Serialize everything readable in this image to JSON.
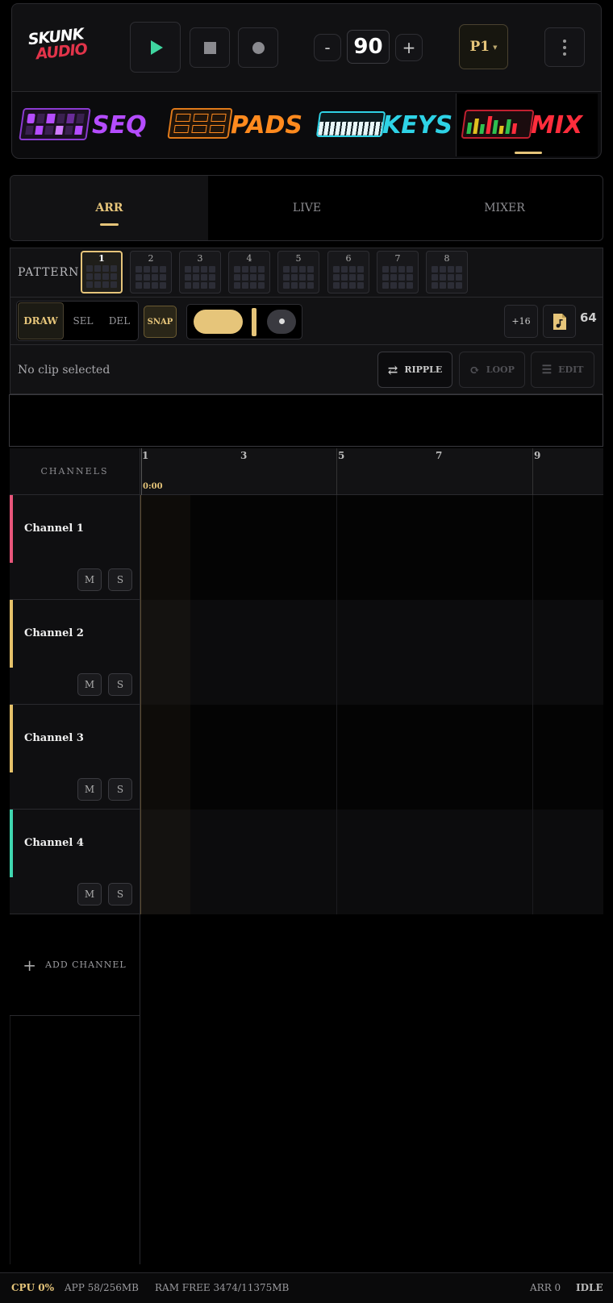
{
  "header": {
    "logo_line1": "SKUNK",
    "logo_line2": "AUDIO",
    "tempo": "90",
    "tempo_minus": "-",
    "tempo_plus": "+",
    "preset": "P1"
  },
  "modules": [
    {
      "label": "SEQ",
      "color": "#b54cff"
    },
    {
      "label": "PADS",
      "color": "#ff8a1e"
    },
    {
      "label": "KEYS",
      "color": "#2ed3e6"
    },
    {
      "label": "MIX",
      "color": "#ff2d3c"
    }
  ],
  "tabs": [
    "ARR",
    "LIVE",
    "MIXER"
  ],
  "active_tab": "ARR",
  "pattern": {
    "label": "PATTERN",
    "slots": [
      "1",
      "2",
      "3",
      "4",
      "5",
      "6",
      "7",
      "8"
    ],
    "active": "1"
  },
  "tools": {
    "draw": "DRAW",
    "sel": "SEL",
    "del": "DEL",
    "snap": "SNAP",
    "plus16": "+16",
    "length": "64"
  },
  "clip": {
    "status": "No clip selected",
    "ripple": "RIPPLE",
    "loop": "LOOP",
    "edit": "EDIT"
  },
  "timeline": {
    "channels_header": "CHANNELS",
    "bars": [
      "1",
      "3",
      "5",
      "7",
      "9"
    ],
    "time": "0:00"
  },
  "channels": [
    {
      "name": "Channel 1",
      "color": "#e8557a",
      "mute": "M",
      "solo": "S"
    },
    {
      "name": "Channel 2",
      "color": "#e6c26a",
      "mute": "M",
      "solo": "S"
    },
    {
      "name": "Channel 3",
      "color": "#e6c26a",
      "mute": "M",
      "solo": "S"
    },
    {
      "name": "Channel 4",
      "color": "#3fd6b0",
      "mute": "M",
      "solo": "S"
    }
  ],
  "add_channel": "ADD CHANNEL",
  "status": {
    "cpu": "CPU 0%",
    "app": "APP 58/256MB",
    "ram": "RAM FREE 3474/11375MB",
    "arr": "ARR 0",
    "state": "IDLE"
  },
  "colors": {
    "accent": "#e6c57a",
    "play": "#3fd6a0"
  }
}
